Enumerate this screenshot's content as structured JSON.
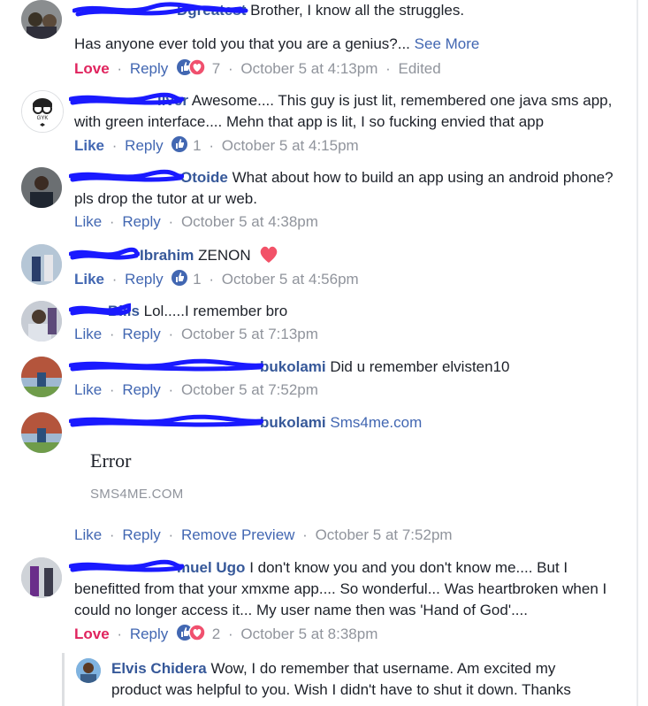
{
  "colors": {
    "link": "#4267b2",
    "name": "#365899",
    "love": "#e0245e",
    "muted": "#90949c",
    "scribble": "#1a1aff"
  },
  "comments": [
    {
      "name": "Dgreatest",
      "text": "Brother, I know all the struggles.",
      "text2": "Has anyone ever told you that you are a genius?...",
      "see_more": "See More",
      "reaction_label": "Love",
      "reply": "Reply",
      "reactions": "like-love",
      "count": "7",
      "time": "October 5 at 4:13pm",
      "edited": "Edited"
    },
    {
      "name": "ilver",
      "text": "Awesome.... This guy is just lit, remembered one java sms app, with green interface.... Mehn that app is lit, I so fucking envied that app",
      "reaction_label": "Like",
      "reply": "Reply",
      "reactions": "like",
      "count": "1",
      "time": "October 5 at 4:15pm"
    },
    {
      "name": "Otoide",
      "text": "What about how to build an app using an android phone? pls drop the tutor at ur web.",
      "reaction_label": "Like",
      "reply": "Reply",
      "time": "October 5 at 4:38pm"
    },
    {
      "name": "Ibrahim",
      "text": "ZENON",
      "reaction_label": "Like",
      "reply": "Reply",
      "reactions": "like",
      "count": "1",
      "time": "October 5 at 4:56pm"
    },
    {
      "name": "Bills",
      "text": "Lol.....I remember bro",
      "reaction_label": "Like",
      "reply": "Reply",
      "time": "October 5 at 7:13pm"
    },
    {
      "name": "bukolami",
      "text": "Did u remember elvisten10",
      "reaction_label": "Like",
      "reply": "Reply",
      "time": "October 5 at 7:52pm"
    },
    {
      "name": "bukolami",
      "text": "Sms4me.com",
      "preview_title": "Error",
      "preview_domain": "SMS4ME.COM",
      "reaction_label": "Like",
      "reply": "Reply",
      "remove_preview": "Remove Preview",
      "time": "October 5 at 7:52pm"
    },
    {
      "name": "muel Ugo",
      "text": "I don't know you and you don't know me.... But I benefitted from that your xmxme app.... So wonderful... Was heartbroken when I could no longer access it... My user name then was 'Hand of God'....",
      "reaction_label": "Love",
      "reply": "Reply",
      "reactions": "like-love",
      "count": "2",
      "time": "October 5 at 8:38pm"
    }
  ],
  "reply": {
    "name": "Elvis Chidera",
    "text": "Wow, I do remember that username. Am excited my product was helpful to you. Wish I didn't have to shut it down. Thanks"
  },
  "icons": {
    "like": "thumbs-up-icon",
    "love": "heart-icon"
  }
}
